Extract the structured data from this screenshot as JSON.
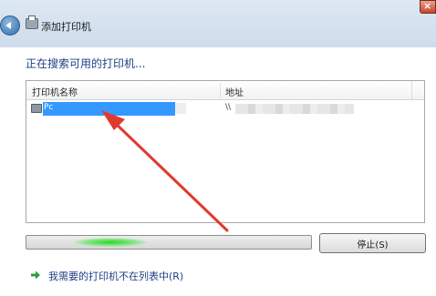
{
  "window": {
    "title": "添加打印机",
    "close_glyph": "×"
  },
  "heading": "正在搜索可用的打印机...",
  "printer_list": {
    "columns": [
      "打印机名称",
      "地址"
    ],
    "rows": [
      {
        "name": "Pc",
        "address": "\\\\"
      }
    ]
  },
  "progress": {
    "state": "indeterminate"
  },
  "stop_button": {
    "label": "停止(S)"
  },
  "not_listed_link": {
    "label": "我需要的打印机不在列表中(R)"
  },
  "colors": {
    "heading": "#1f3f86",
    "selection": "#3399ff",
    "annotation_arrow": "#e03a2f",
    "progress_glow": "#29d629"
  },
  "icons": [
    "back-arrow-icon",
    "printer-icon",
    "close-icon",
    "green-arrow-icon"
  ]
}
